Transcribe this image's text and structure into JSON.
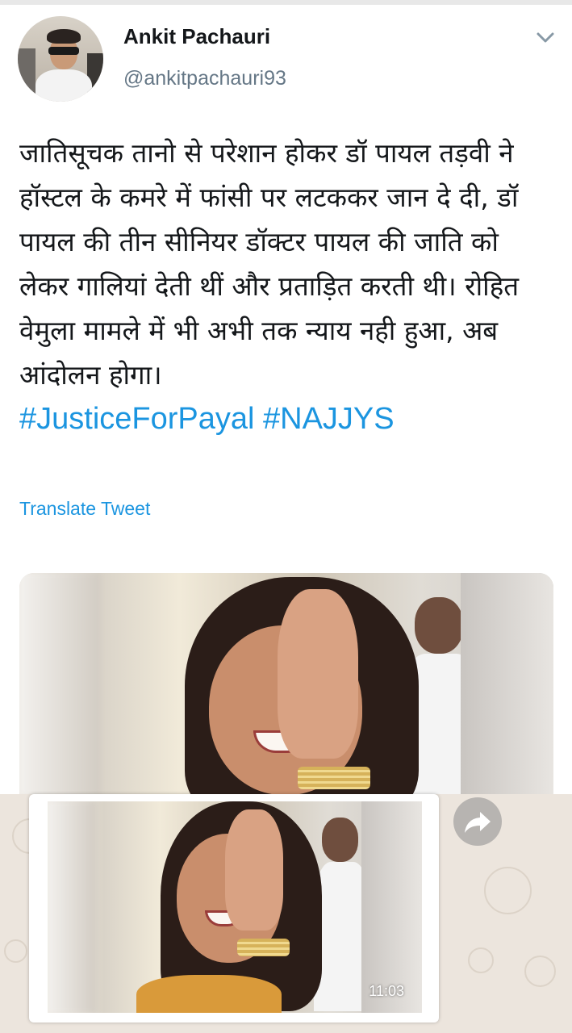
{
  "tweet": {
    "author_name": "Ankit Pachauri",
    "author_handle": "@ankitpachauri93",
    "text": "जातिसूचक तानो से परेशान होकर डॉ पायल तड़वी ने हॉस्टल के कमरे में फांसी पर लटककर जान दे दी, डॉ पायल की तीन सीनियर डॉक्टर पायल की जाति को लेकर गालियां देती थीं और प्रताड़ित करती थी। रोहित वेमुला मामले में भी अभी तक न्याय नही हुआ, अब आंदोलन होगा।",
    "hashtags": "#JusticeForPayal #NAJJYS",
    "translate_label": "Translate Tweet",
    "menu_icon": "chevron-down-icon"
  },
  "whatsapp_preview": {
    "timestamp": "11:03",
    "forward_icon": "forward-icon"
  },
  "colors": {
    "link": "#1b95e0",
    "text": "#14171a",
    "muted": "#657786",
    "chat_bg": "#ece5dd"
  }
}
